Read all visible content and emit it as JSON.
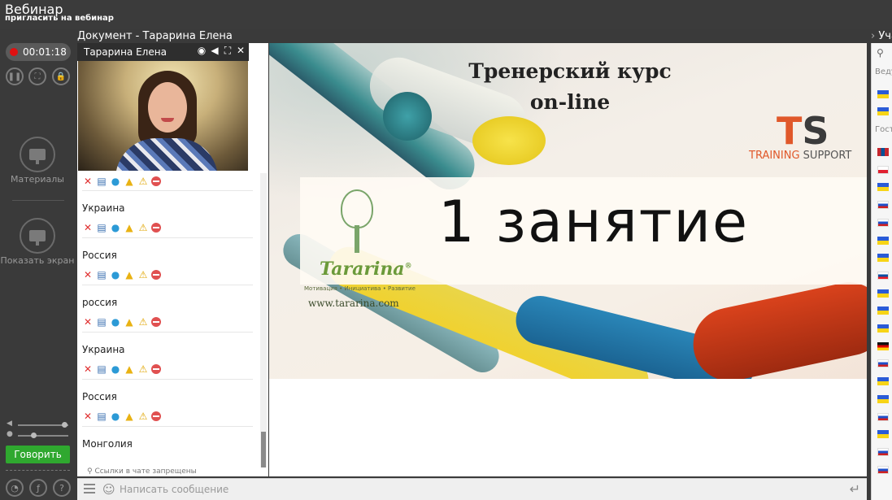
{
  "header": {
    "title": "Вебинар",
    "invite_link": "пригласить на вебинар",
    "document_title": "Документ - Тарарина Елена",
    "participants_title": "Уча"
  },
  "sidebar": {
    "timer": "00:01:18",
    "materials_label": "Материалы",
    "share_screen_label": "Показать экран",
    "talk_button": "Говорить"
  },
  "webcam": {
    "presenter_name": "Тарарина Елена"
  },
  "chat": {
    "messages": [
      {
        "text": "Украина"
      },
      {
        "text": "Россия"
      },
      {
        "text": "россия"
      },
      {
        "text": "Украина"
      },
      {
        "text": "Россия"
      },
      {
        "text": "Монголия"
      }
    ],
    "links_notice": "Ссылки в чате запрещены",
    "input_placeholder": "Написать сообщение"
  },
  "slide": {
    "title_line1": "Тренерский курс",
    "title_line2": "on-line",
    "ts_logo_letters": [
      "T",
      "S"
    ],
    "ts_logo_sub1": "TRAINING",
    "ts_logo_sub2": "SUPPORT",
    "lesson_text": "1 занятие",
    "brand": "Tararina",
    "brand_mark": "®",
    "tagline": "Мотивация • Инициатива • Развитие",
    "website": "www.tararina.com"
  },
  "participants": {
    "hosts_label": "Веду",
    "guests_label": "Гост",
    "host_flags": [
      "ua",
      "ua"
    ],
    "guest_flags": [
      "mn",
      "pl",
      "ua",
      "ru",
      "ru",
      "ua",
      "ua",
      "sk",
      "ua",
      "ua",
      "ua",
      "de",
      "ru",
      "ua",
      "ua",
      "ru",
      "ua",
      "ru",
      "ru"
    ]
  },
  "colors": {
    "accent_green": "#2fa82f",
    "record_red": "#e01010",
    "ts_orange": "#e0582a",
    "tararina_green": "#6b9a3a"
  }
}
